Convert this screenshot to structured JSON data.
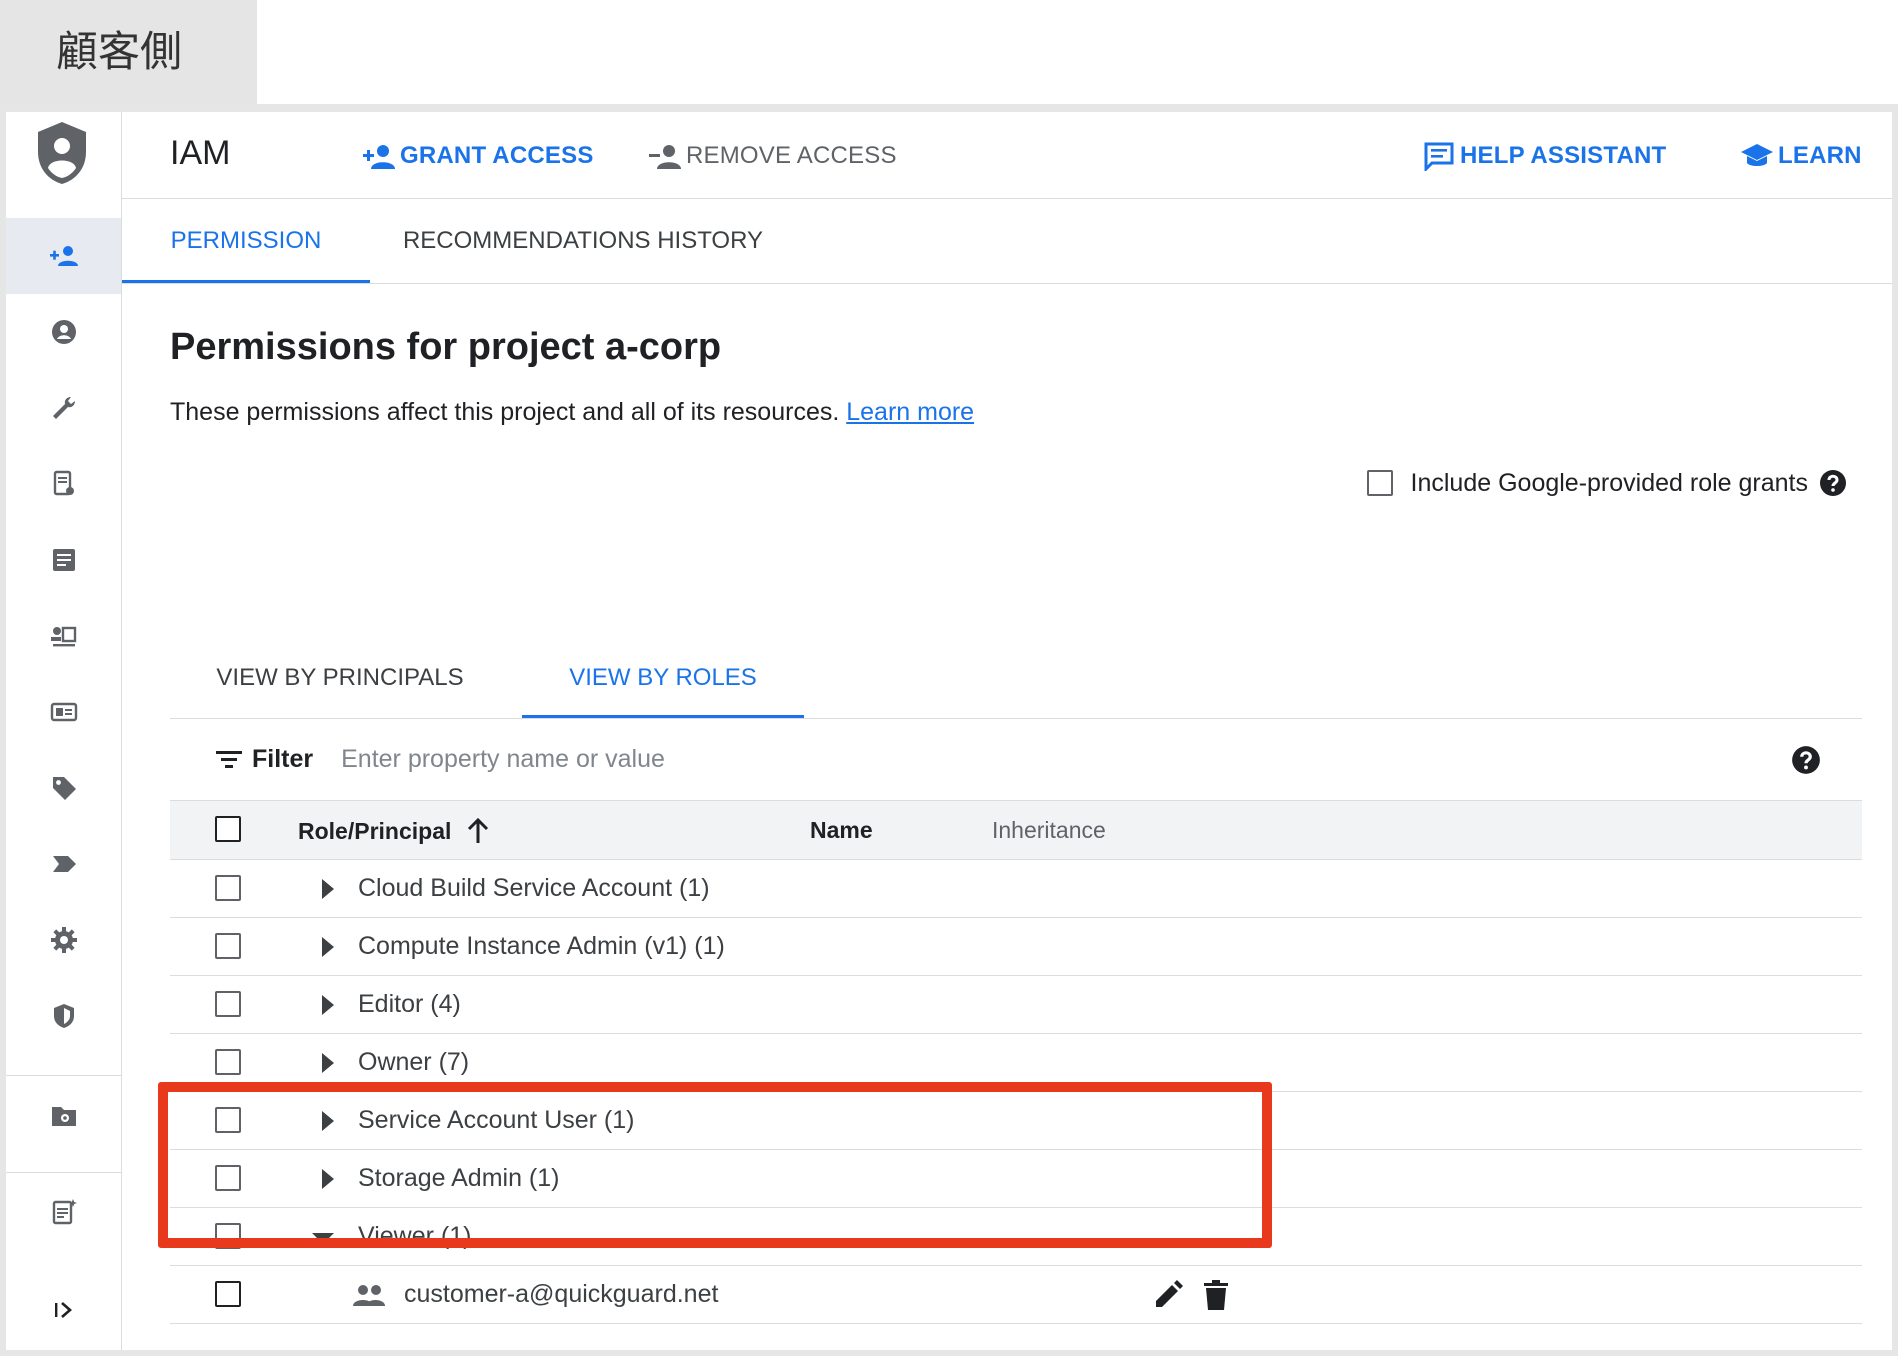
{
  "caption": "顧客側",
  "app": {
    "title": "IAM",
    "actions": {
      "grant_access": "GRANT ACCESS",
      "remove_access": "REMOVE ACCESS",
      "help_assistant": "HELP ASSISTANT",
      "learn": "LEARN"
    }
  },
  "tabs": {
    "permission": "PERMISSION",
    "recommendations_history": "RECOMMENDATIONS HISTORY"
  },
  "page": {
    "title": "Permissions for project a-corp",
    "description": "These permissions affect this project and all of its resources. ",
    "learn_more": "Learn more",
    "include_google_grants": "Include Google-provided role grants"
  },
  "view_tabs": {
    "principals": "VIEW BY PRINCIPALS",
    "roles": "VIEW BY ROLES"
  },
  "filter": {
    "label": "Filter",
    "placeholder": "Enter property name or value"
  },
  "table": {
    "columns": {
      "role_principal": "Role/Principal",
      "name": "Name",
      "inheritance": "Inheritance"
    },
    "rows": [
      {
        "label": "Cloud Build Service Account (1)",
        "expanded": false
      },
      {
        "label": "Compute Instance Admin (v1) (1)",
        "expanded": false
      },
      {
        "label": "Editor (4)",
        "expanded": false
      },
      {
        "label": "Owner (7)",
        "expanded": false
      },
      {
        "label": "Service Account User (1)",
        "expanded": false
      },
      {
        "label": "Storage Admin (1)",
        "expanded": false
      },
      {
        "label": "Viewer (1)",
        "expanded": true
      }
    ],
    "member": "customer-a@quickguard.net"
  },
  "colors": {
    "accent": "#1a73e8",
    "highlight": "#e8391d"
  }
}
